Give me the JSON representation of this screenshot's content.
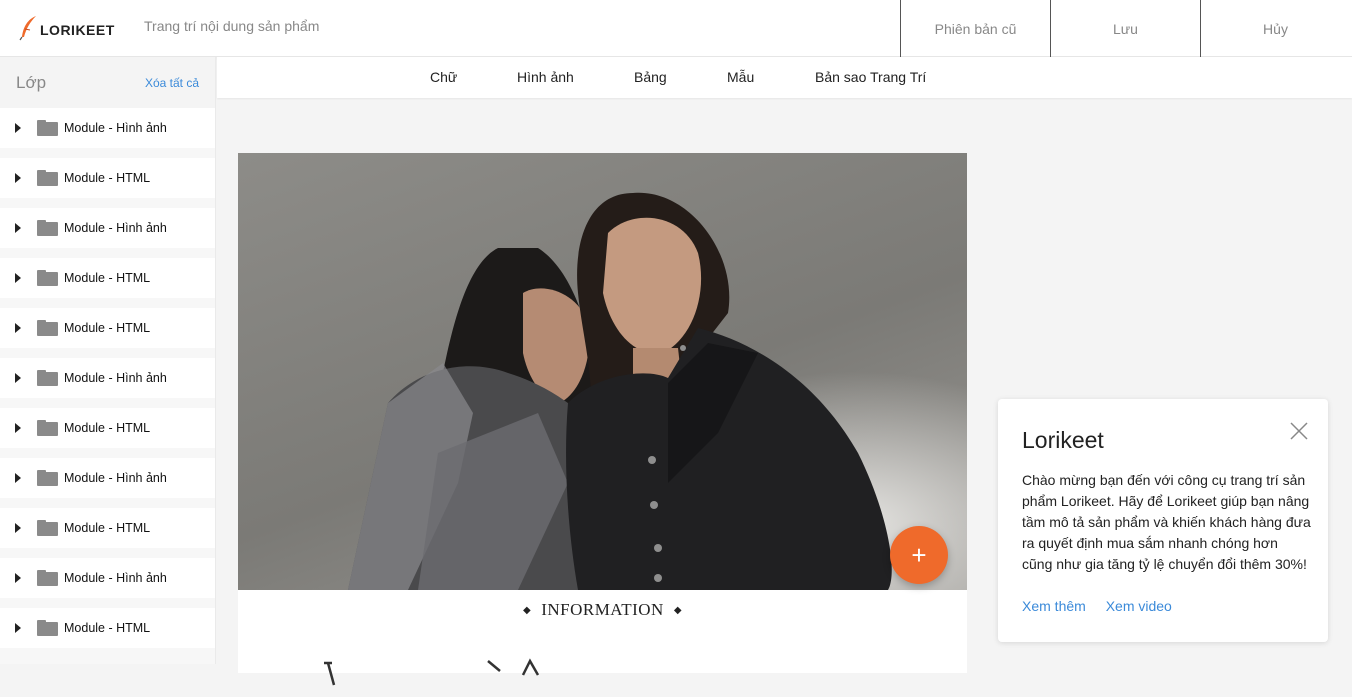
{
  "header": {
    "logo_text": "LORIKEET",
    "title": "Trang trí nội dung sản phẩm",
    "buttons": [
      "Phiên bản cũ",
      "Lưu",
      "Hủy"
    ]
  },
  "sidebar": {
    "title": "Lớp",
    "clear_all": "Xóa tất cả",
    "layers": [
      "Module - Hình ảnh",
      "Module - HTML",
      "Module - Hình ảnh",
      "Module - HTML",
      "Module - HTML",
      "Module - Hình ảnh",
      "Module - HTML",
      "Module - Hình ảnh",
      "Module - HTML",
      "Module - Hình ảnh",
      "Module - HTML"
    ]
  },
  "toolbar": {
    "tabs": [
      "Chữ",
      "Hình ảnh",
      "Bảng",
      "Mẫu",
      "Bản sao Trang Trí"
    ]
  },
  "canvas": {
    "info_heading": "INFORMATION",
    "fab_label": "+"
  },
  "popup": {
    "title": "Lorikeet",
    "body": "Chào mừng bạn đến với công cụ trang trí sản phẩm Lorikeet. Hãy để Lorikeet giúp bạn nâng tầm mô tả sản phẩm và khiến khách hàng đưa ra quyết định mua sắm nhanh chóng hơn cũng như gia tăng tỷ lệ chuyển đổi thêm 30%!",
    "link_more": "Xem thêm",
    "link_video": "Xem video"
  },
  "colors": {
    "accent": "#ef6a2b",
    "link": "#3b8ad9"
  }
}
